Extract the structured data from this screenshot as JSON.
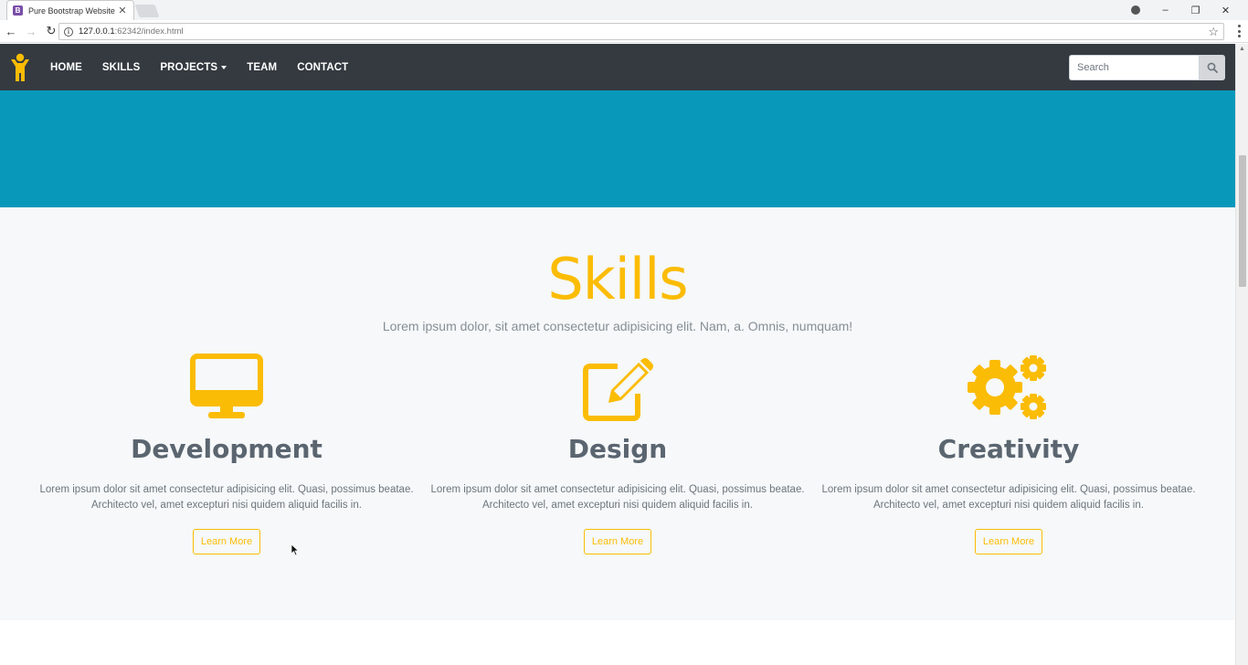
{
  "browser": {
    "tab_title": "Pure Bootstrap Website",
    "favicon_letter": "B",
    "url_host": "127.0.0.1",
    "url_rest": ":62342/index.html"
  },
  "navbar": {
    "links": [
      "HOME",
      "SKILLS",
      "PROJECTS",
      "TEAM",
      "CONTACT"
    ],
    "search_placeholder": "Search"
  },
  "skills": {
    "title": "Skills",
    "lead": "Lorem ipsum dolor, sit amet consectetur adipisicing elit. Nam, a. Omnis, numquam!",
    "items": [
      {
        "icon": "desktop-icon",
        "title": "Development",
        "text": "Lorem ipsum dolor sit amet consectetur adipisicing elit. Quasi, possimus beatae. Architecto vel, amet excepturi nisi quidem aliquid facilis in.",
        "button": "Learn More"
      },
      {
        "icon": "edit-icon",
        "title": "Design",
        "text": "Lorem ipsum dolor sit amet consectetur adipisicing elit. Quasi, possimus beatae. Architecto vel, amet excepturi nisi quidem aliquid facilis in.",
        "button": "Learn More"
      },
      {
        "icon": "cogs-icon",
        "title": "Creativity",
        "text": "Lorem ipsum dolor sit amet consectetur adipisicing elit. Quasi, possimus beatae. Architecto vel, amet excepturi nisi quidem aliquid facilis in.",
        "button": "Learn More"
      }
    ]
  },
  "colors": {
    "navbar": "#343a40",
    "hero": "#0899ba",
    "accent": "#fbbc05",
    "section_bg": "#f6f8f9"
  }
}
